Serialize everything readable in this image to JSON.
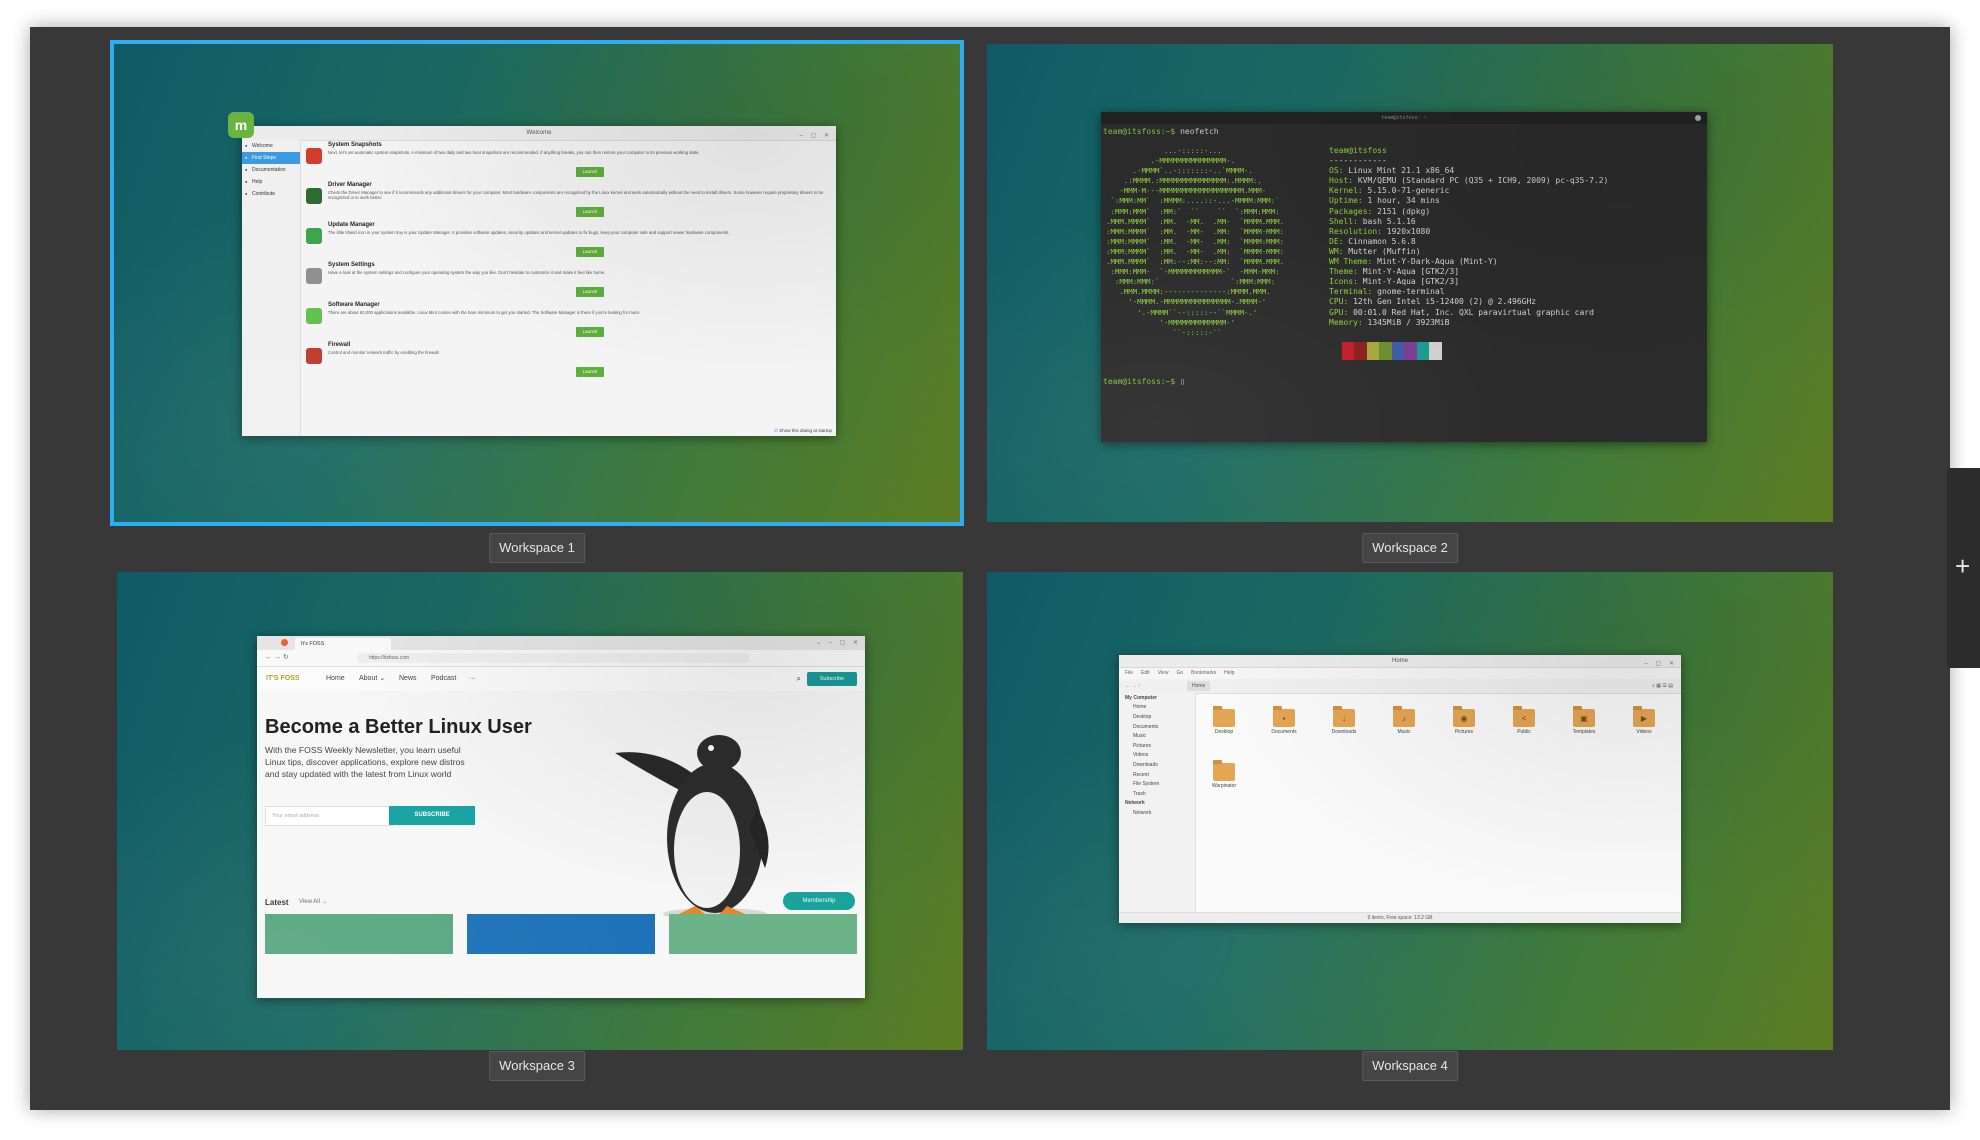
{
  "workspaces": [
    {
      "label": "Workspace 1"
    },
    {
      "label": "Workspace 2"
    },
    {
      "label": "Workspace 3"
    },
    {
      "label": "Workspace 4"
    }
  ],
  "add_workspace_glyph": "+",
  "welcome": {
    "title": "Welcome",
    "badge": "m",
    "sidebar": [
      "Welcome",
      "First Steps",
      "Documentation",
      "Help",
      "Contribute"
    ],
    "items": [
      {
        "title": "System Snapshots",
        "desc": "Next, let's set automatic system snapshots. A minimum of two daily and two boot snapshots are recommended. If anything breaks, you can then restore your computer to its previous working state.",
        "color": "#d33b2c"
      },
      {
        "title": "Driver Manager",
        "desc": "Check the Driver Manager to see if it recommends any additional drivers for your computer. Most hardware components are recognized by the Linux kernel and work automatically without the need to install drivers. Some however require proprietary drivers to be recognized or to work better.",
        "color": "#2e6b32"
      },
      {
        "title": "Update Manager",
        "desc": "The little shield icon in your system tray is your Update Manager. It provides software updates, security updates and kernel updates to fix bugs, keep your computer safe and support newer hardware components.",
        "color": "#3aa648"
      },
      {
        "title": "System Settings",
        "desc": "Have a look at the system settings and configure your operating system the way you like. Don't hesitate to customize it and make it feel like home.",
        "color": "#8e8e8e"
      },
      {
        "title": "Software Manager",
        "desc": "There are about 60,000 applications available. Linux Mint comes with the bare minimum to get you started. The Software Manager is there if you're looking for more.",
        "color": "#5fbf4e"
      },
      {
        "title": "Firewall",
        "desc": "Control and monitor network traffic by enabling the firewall.",
        "color": "#c0392b"
      }
    ],
    "launch_label": "Launch",
    "footer": "Show this dialog at startup"
  },
  "terminal": {
    "title": "team@itsfoss: ~",
    "prompt": "team@itsfoss:~$",
    "command": " neofetch",
    "ascii": "             ...-:::::-...\n          .-MMMMMMMMMMMMMMM-.\n      .-MMMM`..-:::::::-..`MMMM-.\n    .:MMMM.:MMMMMMMMMMMMMMM:.MMMM:.\n   -MMM-M---MMMMMMMMMMMMMMMMMMM.MMM-\n `:MMM:MM`  :MMMM:....::-...-MMMM:MMM:`\n :MMM:MMM`  :MM:`  ``    ``  `:MMM:MMM:\n.MMM.MMMM`  :MM.  -MM.  .MM-  `MMMM.MMM.\n:MMM:MMMM`  :MM.  -MM-  .MM:  `MMMM-MMM:\n:MMM:MMMM`  :MM.  -MM-  .MM:  `MMMM:MMM:\n:MMM:MMMM`  :MM.  -MM-  .MM:  `MMMM-MMM:\n.MMM.MMMM`  :MM:--:MM:--:MM:  `MMMM.MMM.\n :MMM:MMM-  `-MMMMMMMMMMMM-`  -MMM-MMM:\n  :MMM:MMM:`                `:MMM:MMM:\n   .MMM.MMMM:--------------:MMMM.MMM.\n     '-MMMM.-MMMMMMMMMMMMMMM-.MMMM-'\n       '.-MMMM``--:::::--``MMMM-.'\n            '-MMMMMMMMMMMMM-'\n               ``-:::::-``",
    "user": "team@itsfoss",
    "sep": "------------",
    "info": [
      {
        "k": "OS:",
        "v": " Linux Mint 21.1 x86_64"
      },
      {
        "k": "Host:",
        "v": " KVM/QEMU (Standard PC (Q35 + ICH9, 2009) pc-q35-7.2)"
      },
      {
        "k": "Kernel:",
        "v": " 5.15.0-71-generic"
      },
      {
        "k": "Uptime:",
        "v": " 1 hour, 34 mins"
      },
      {
        "k": "Packages:",
        "v": " 2151 (dpkg)"
      },
      {
        "k": "Shell:",
        "v": " bash 5.1.16"
      },
      {
        "k": "Resolution:",
        "v": " 1920x1080"
      },
      {
        "k": "DE:",
        "v": " Cinnamon 5.6.8"
      },
      {
        "k": "WM:",
        "v": " Mutter (Muffin)"
      },
      {
        "k": "WM Theme:",
        "v": " Mint-Y-Dark-Aqua (Mint-Y)"
      },
      {
        "k": "Theme:",
        "v": " Mint-Y-Aqua [GTK2/3]"
      },
      {
        "k": "Icons:",
        "v": " Mint-Y-Aqua [GTK2/3]"
      },
      {
        "k": "Terminal:",
        "v": " gnome-terminal"
      },
      {
        "k": "CPU:",
        "v": " 12th Gen Intel i5-12400 (2) @ 2.496GHz"
      },
      {
        "k": "GPU:",
        "v": " 00:01.0 Red Hat, Inc. QXL paravirtual graphic card"
      },
      {
        "k": "Memory:",
        "v": " 1345MiB / 3923MiB"
      }
    ],
    "swatches": [
      "#2b2b2b",
      "#c01c28",
      "#8a1f1f",
      "#a8a53a",
      "#6a8c2a",
      "#3c5aa8",
      "#7a3c8f",
      "#1a9a8f",
      "#cfcfcf"
    ]
  },
  "browser": {
    "tab_title": "It's FOSS",
    "url": "https://itsfoss.com",
    "logo": "IT'S FOSS",
    "nav": [
      "Home",
      "About ⌄",
      "News",
      "Podcast",
      "···"
    ],
    "subscribe_label": "Subscribe",
    "hero_title": "Become a Better Linux User",
    "hero_text": "With the FOSS Weekly Newsletter, you learn useful Linux tips, discover applications, explore new distros and stay updated with the latest from Linux world",
    "email_placeholder": "Your email address",
    "subscribe_button": "SUBSCRIBE",
    "latest": "Latest",
    "view_all": "View All →",
    "membership": "Membership"
  },
  "files": {
    "title": "Home",
    "menu": [
      "File",
      "Edit",
      "View",
      "Go",
      "Bookmarks",
      "Help"
    ],
    "location": "Home",
    "sidebar": [
      {
        "label": "My Computer",
        "hdr": true
      },
      {
        "label": "Home"
      },
      {
        "label": "Desktop"
      },
      {
        "label": "Documents"
      },
      {
        "label": "Music"
      },
      {
        "label": "Pictures"
      },
      {
        "label": "Videos"
      },
      {
        "label": "Downloads"
      },
      {
        "label": "Recent"
      },
      {
        "label": "File System"
      },
      {
        "label": "Trash"
      },
      {
        "label": "Network",
        "hdr": true
      },
      {
        "label": "Network"
      }
    ],
    "folders": [
      {
        "name": "Desktop",
        "glyph": ""
      },
      {
        "name": "Documents",
        "glyph": "▪"
      },
      {
        "name": "Downloads",
        "glyph": "↓"
      },
      {
        "name": "Music",
        "glyph": "♪"
      },
      {
        "name": "Pictures",
        "glyph": "◉"
      },
      {
        "name": "Public",
        "glyph": "<"
      },
      {
        "name": "Templates",
        "glyph": "▣"
      },
      {
        "name": "Videos",
        "glyph": "▶"
      },
      {
        "name": "Warpinator",
        "glyph": ""
      }
    ],
    "status": "9 items, Free space: 13.2 GB"
  }
}
